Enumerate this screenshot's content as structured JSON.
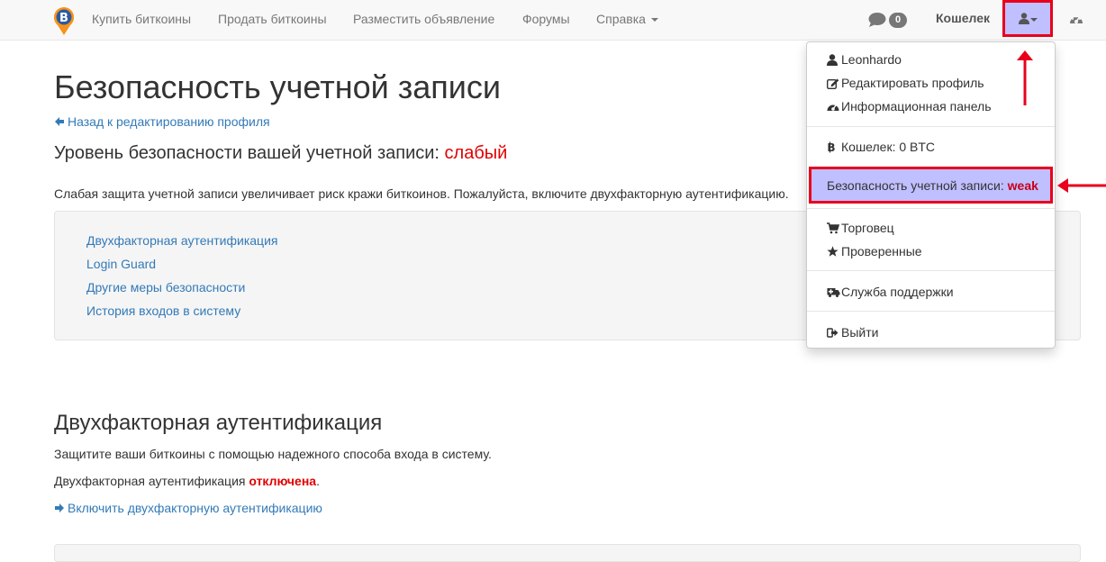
{
  "navbar": {
    "buy": "Купить биткоины",
    "sell": "Продать биткоины",
    "post_ad": "Разместить объявление",
    "forums": "Форумы",
    "help": "Справка",
    "messages_count": "0",
    "wallet": "Кошелек"
  },
  "page": {
    "title": "Безопасность учетной записи",
    "back_link": "Назад к редактированию профиля",
    "level_label": "Уровень безопасности вашей учетной записи:",
    "level_value": "слабый",
    "warning": "Слабая защита учетной записи увеличивает риск кражи биткоинов. Пожалуйста, включите двухфакторную аутентификацию.",
    "links": [
      "Двухфакторная аутентификация",
      "Login Guard",
      "Другие меры безопасности",
      "История входов в систему"
    ],
    "tfa_heading": "Двухфакторная аутентификация",
    "tfa_text": "Защитите ваши биткоины с помощью надежного способа входа в систему.",
    "tfa_status_prefix": "Двухфакторная аутентификация",
    "tfa_status_value": "отключена",
    "tfa_status_suffix": ".",
    "tfa_enable_link": "Включить двухфакторную аутентификацию"
  },
  "dropdown": {
    "username": "Leonhardo",
    "edit_profile": "Редактировать профиль",
    "dashboard": "Информационная панель",
    "wallet_balance": "Кошелек: 0 BTC",
    "security_label": "Безопасность учетной записи:",
    "security_value": "weak",
    "merchant": "Торговец",
    "trusted": "Проверенные",
    "support": "Служба поддержки",
    "logout": "Выйти"
  },
  "colors": {
    "link": "#337ab7",
    "danger": "#e00000",
    "highlight_fill": "#c0bfff",
    "annotation_red": "#e8001c"
  }
}
